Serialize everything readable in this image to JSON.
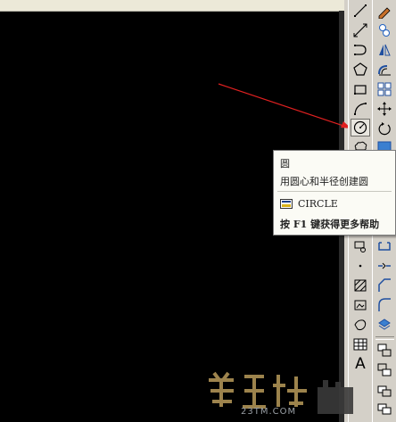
{
  "tooltip": {
    "title": "圆",
    "description": "用圆心和半径创建圆",
    "command_icon": "command-window-icon",
    "command": "CIRCLE",
    "help_hint": "按 F1 键获得更多帮助"
  },
  "toolbars": {
    "draw": {
      "buttons": [
        {
          "name": "line-tool-icon"
        },
        {
          "name": "construction-line-icon"
        },
        {
          "name": "polyline-icon"
        },
        {
          "name": "polygon-icon"
        },
        {
          "name": "rectangle-icon"
        },
        {
          "name": "arc-icon"
        },
        {
          "name": "circle-icon",
          "state": "hovered"
        },
        {
          "name": "revision-cloud-icon"
        },
        {
          "name": "insert-block-icon"
        },
        {
          "name": "point-icon"
        },
        {
          "name": "hatch-icon"
        },
        {
          "name": "region-icon"
        },
        {
          "name": "table-icon"
        },
        {
          "name": "multiline-text-icon",
          "glyph": "A"
        }
      ]
    },
    "modify": {
      "buttons": [
        {
          "name": "erase-icon"
        },
        {
          "name": "copy-icon"
        },
        {
          "name": "mirror-icon"
        },
        {
          "name": "offset-icon"
        },
        {
          "name": "array-icon"
        },
        {
          "name": "move-icon"
        },
        {
          "name": "rotate-icon"
        },
        {
          "name": "scale-icon"
        },
        {
          "name": "stretch-icon"
        },
        {
          "name": "join-icon"
        },
        {
          "name": "chamfer-icon"
        },
        {
          "name": "fillet-icon"
        },
        {
          "name": "explode-icon"
        },
        {
          "name": "draw-order-icon"
        }
      ]
    }
  },
  "annotation": {
    "arrow_color": "#e02020"
  },
  "watermark": {
    "subtext": "23TM.COM"
  }
}
